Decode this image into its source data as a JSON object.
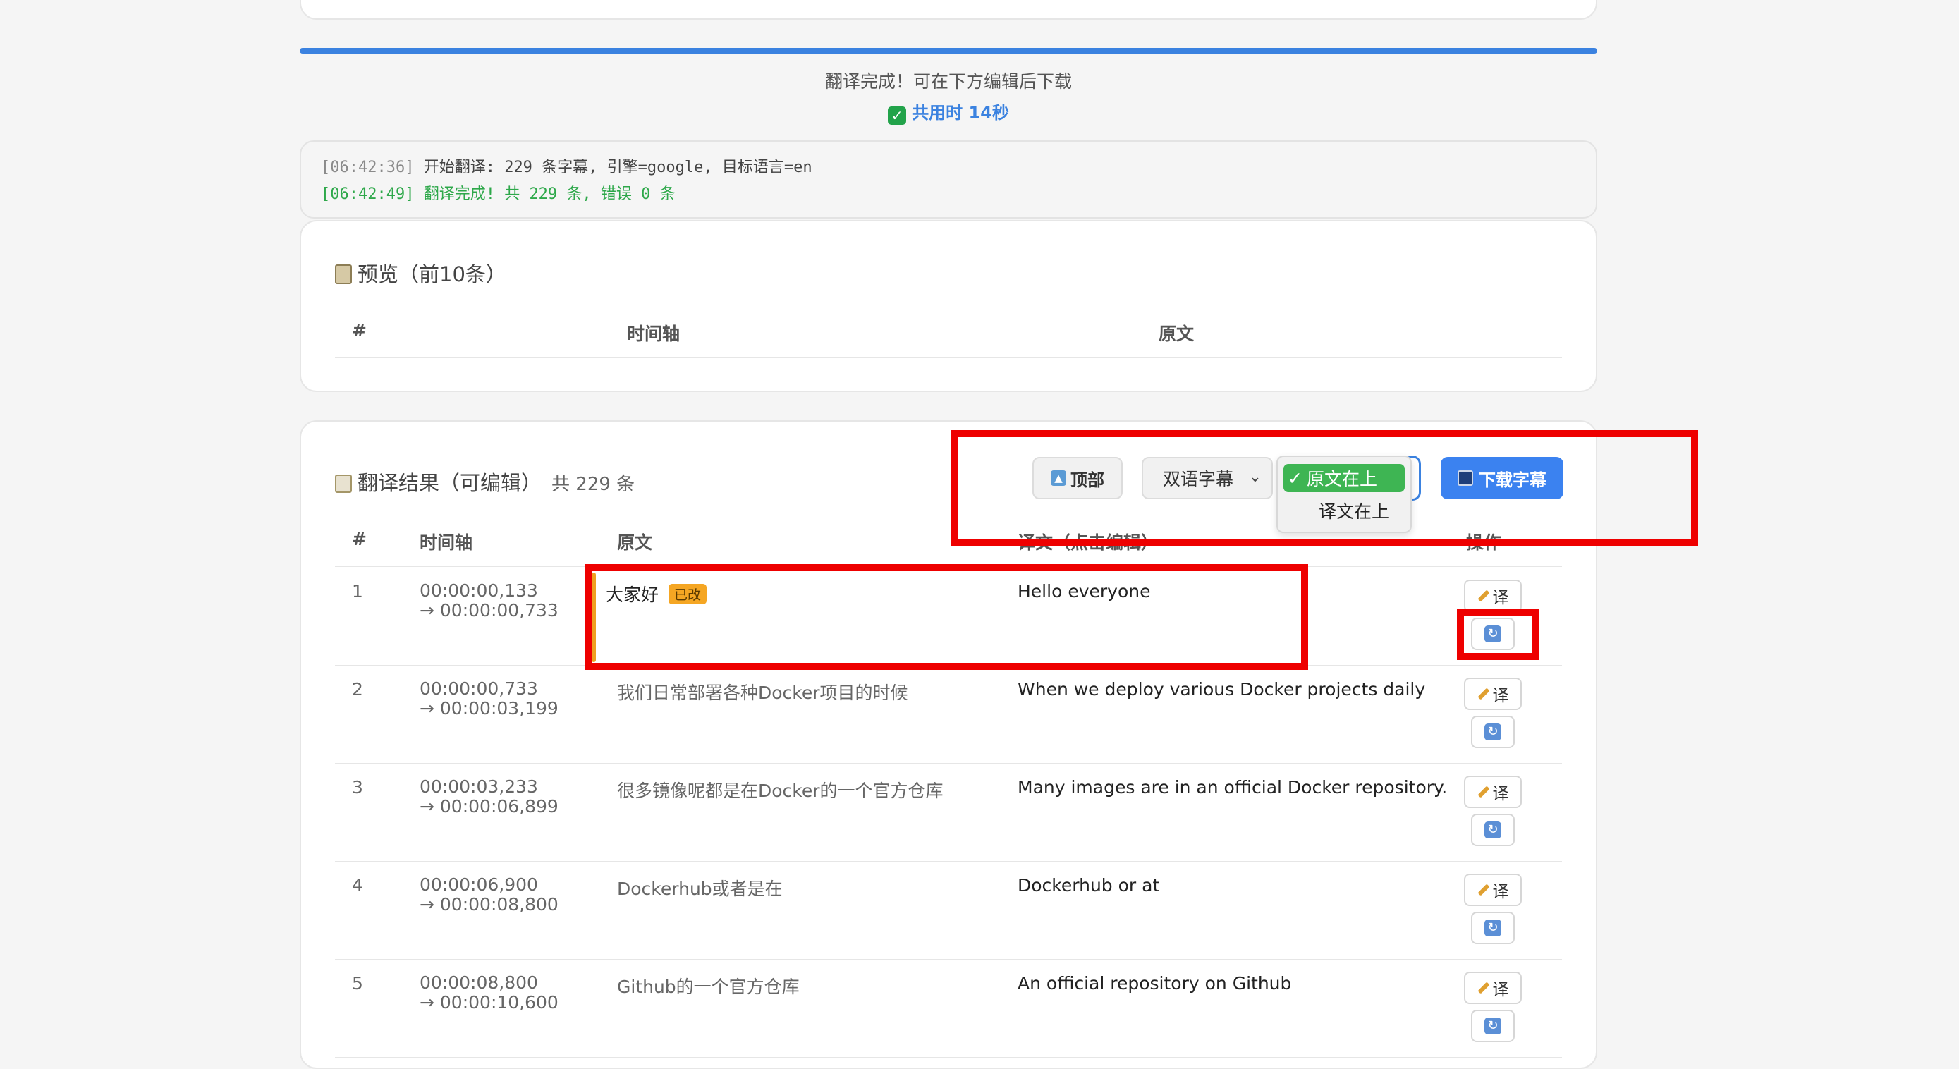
{
  "status": {
    "complete_text": "翻译完成！可在下方编辑后下载",
    "elapsed_text": "共用时 14秒"
  },
  "log": [
    {
      "time": "[06:42:36]",
      "message": "开始翻译: 229 条字幕, 引擎=google, 目标语言=en"
    },
    {
      "time": "[06:42:49]",
      "message": "翻译完成! 共 229 条, 错误 0 条"
    }
  ],
  "preview": {
    "title": "预览（前10条）",
    "columns": [
      "#",
      "时间轴",
      "原文"
    ]
  },
  "results": {
    "title": "翻译结果（可编辑）",
    "count": "共 229 条",
    "toolbar": {
      "top_label": "顶部",
      "mode_value": "双语字幕",
      "order_options": [
        "原文在上",
        "译文在上"
      ],
      "download_label": "下载字幕"
    },
    "columns": [
      "#",
      "时间轴",
      "原文",
      "译文（点击编辑）",
      "操作"
    ],
    "modified_badge": "已改",
    "action_translate_label": "译",
    "rows": [
      {
        "num": "1",
        "start": "00:00:00,133",
        "end": "→ 00:00:00,733",
        "source": "大家好",
        "translation": "Hello everyone",
        "modified": true
      },
      {
        "num": "2",
        "start": "00:00:00,733",
        "end": "→ 00:00:03,199",
        "source": "我们日常部署各种Docker项目的时候",
        "translation": "When we deploy various Docker projects daily",
        "modified": false
      },
      {
        "num": "3",
        "start": "00:00:03,233",
        "end": "→ 00:00:06,899",
        "source": "很多镜像呢都是在Docker的一个官方仓库",
        "translation": "Many images are in an official Docker repository.",
        "modified": false
      },
      {
        "num": "4",
        "start": "00:00:06,900",
        "end": "→ 00:00:08,800",
        "source": "Dockerhub或者是在",
        "translation": "Dockerhub or at",
        "modified": false
      },
      {
        "num": "5",
        "start": "00:00:08,800",
        "end": "→ 00:00:10,600",
        "source": "Github的一个官方仓库",
        "translation": "An official repository on Github",
        "modified": false
      }
    ]
  },
  "colors": {
    "accent": "#3b82f0",
    "success": "#2ea84a",
    "modified": "#f5a623",
    "annotation": "#ee0000"
  }
}
